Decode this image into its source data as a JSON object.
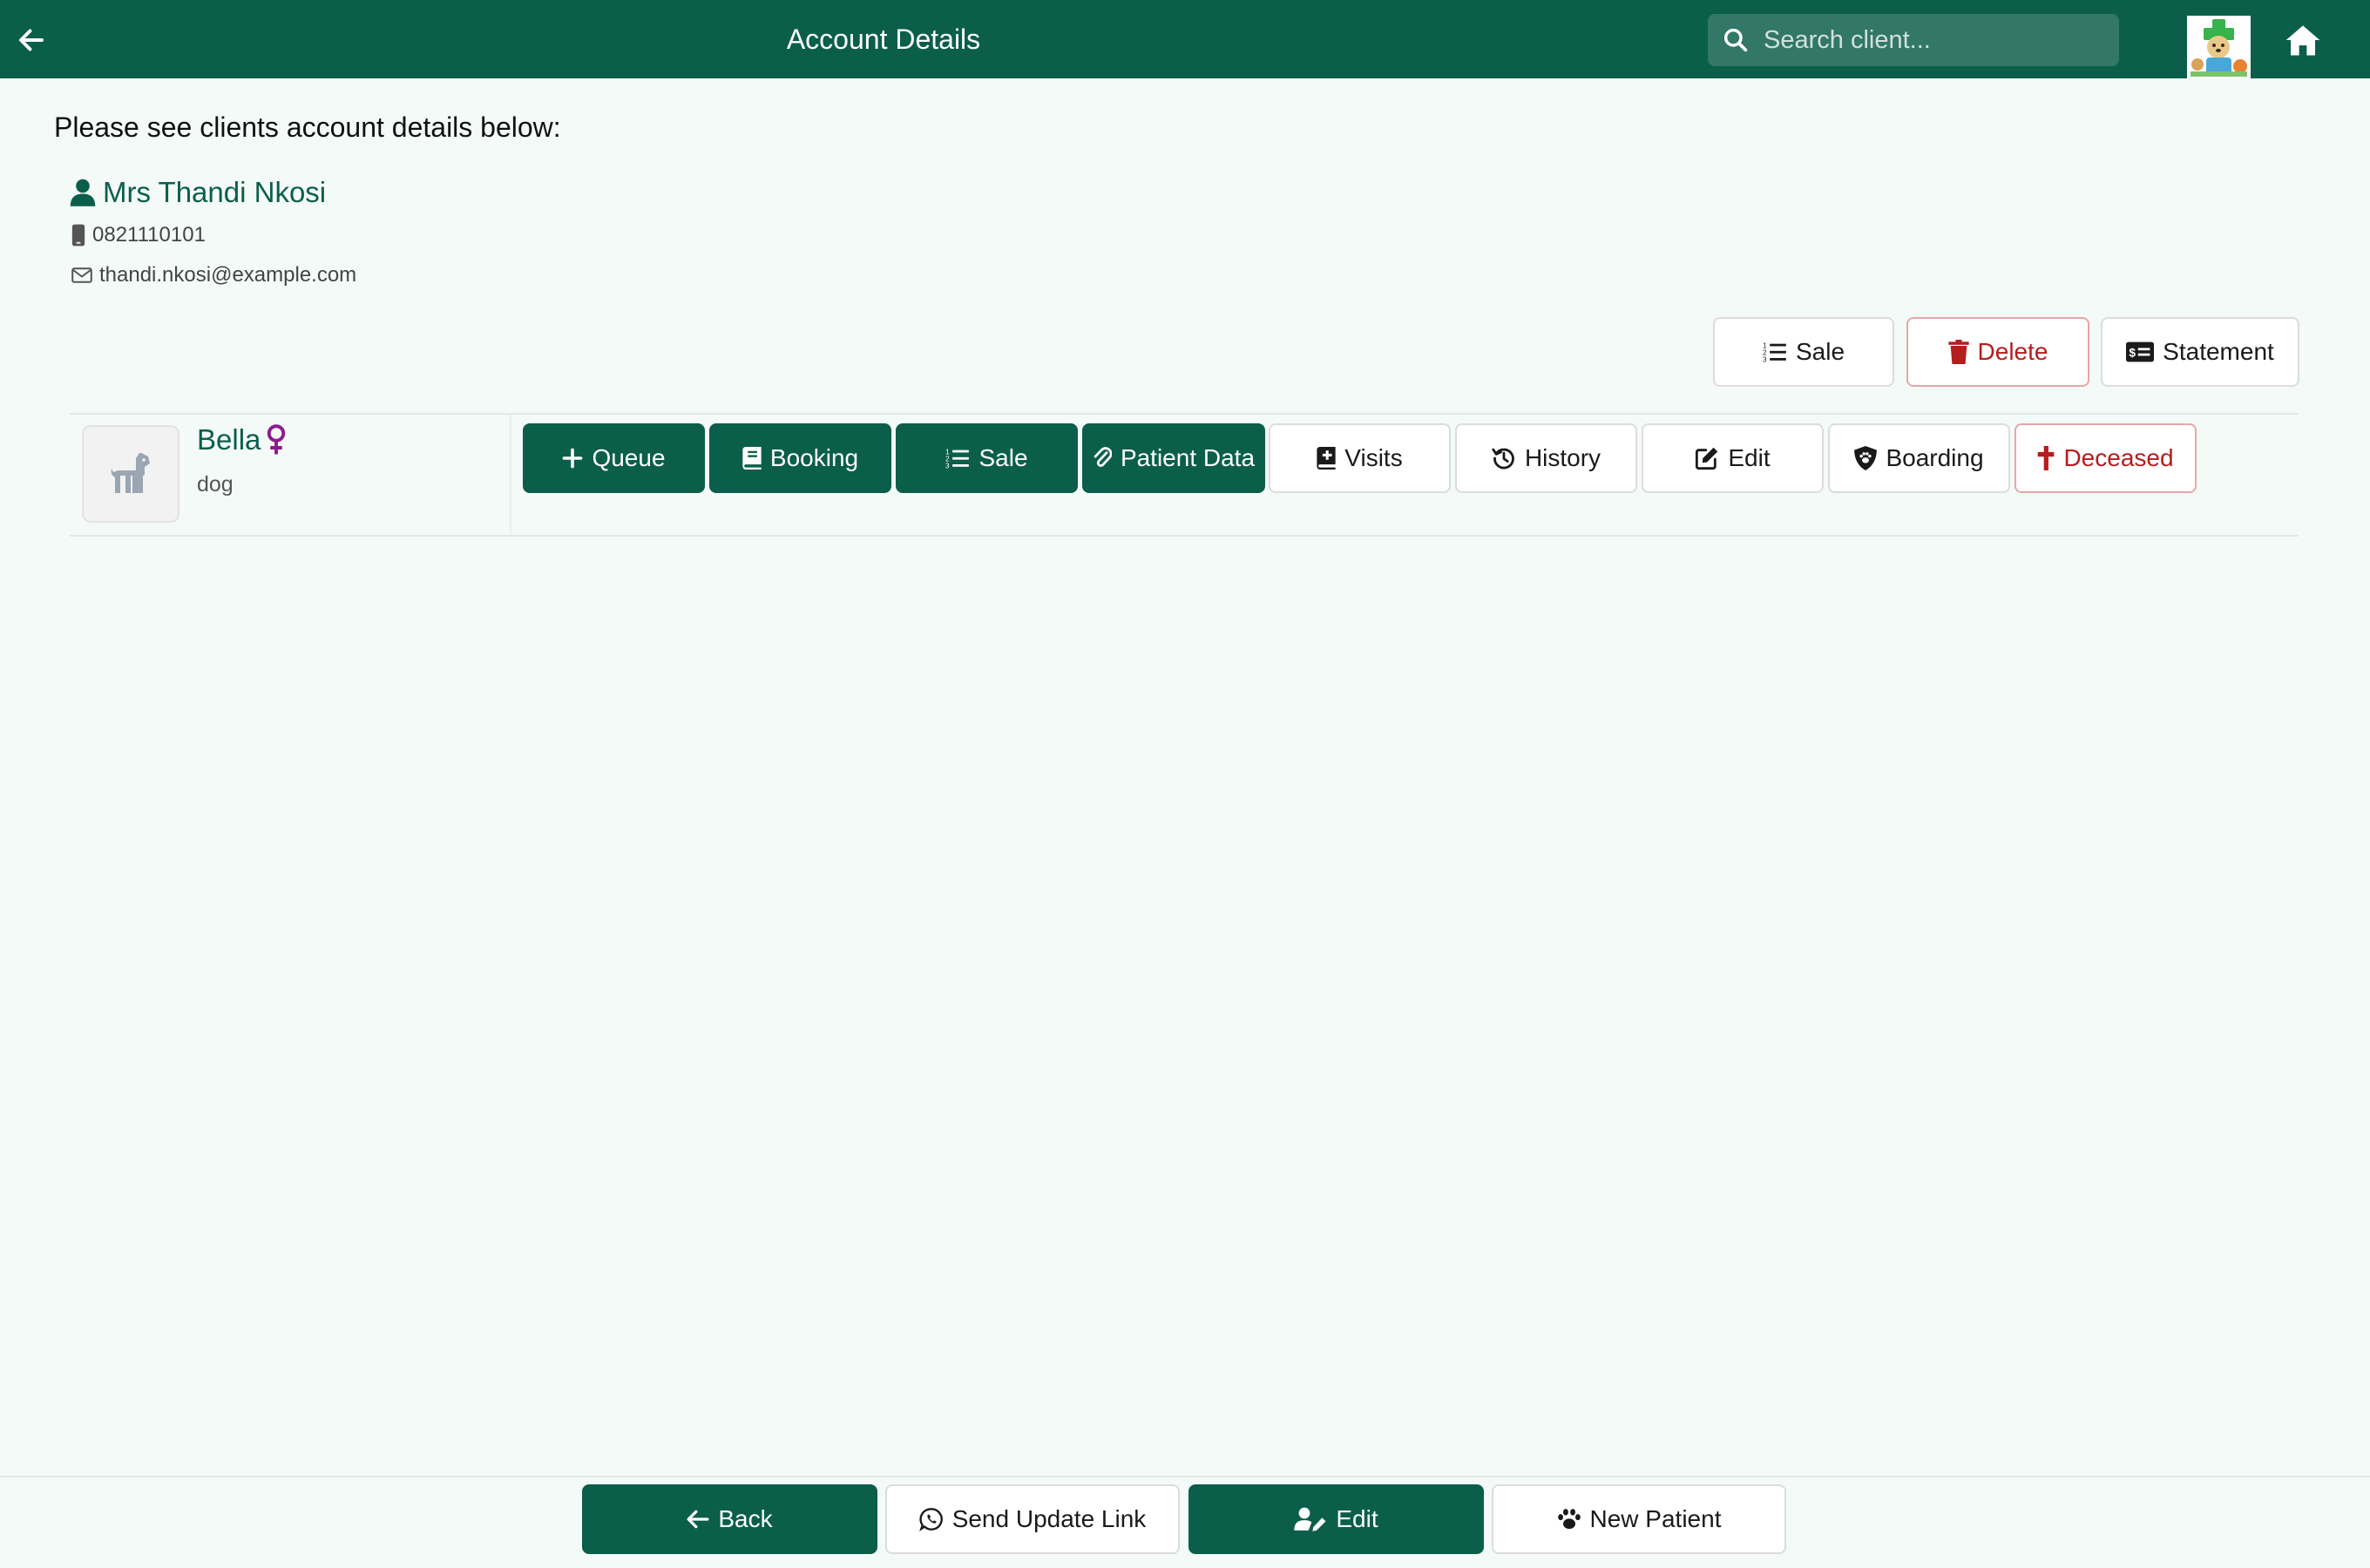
{
  "header": {
    "title": "Account Details",
    "search_placeholder": "Search client...",
    "back_icon": "arrow-left-icon",
    "home_icon": "home-icon"
  },
  "intro_text": "Please see clients account details below:",
  "client": {
    "name": "Mrs Thandi Nkosi",
    "phone": "0821110101",
    "email": "thandi.nkosi@example.com"
  },
  "account_actions": {
    "sale": "Sale",
    "delete": "Delete",
    "statement": "Statement"
  },
  "patient": {
    "name": "Bella",
    "species": "dog",
    "sex_icon": "female-icon",
    "actions": {
      "queue": "Queue",
      "booking": "Booking",
      "sale": "Sale",
      "patient_data": "Patient Data",
      "visits": "Visits",
      "history": "History",
      "edit": "Edit",
      "boarding": "Boarding",
      "deceased": "Deceased"
    }
  },
  "footer": {
    "back": "Back",
    "send_update_link": "Send Update Link",
    "edit": "Edit",
    "new_patient": "New Patient"
  },
  "colors": {
    "primary": "#0b5e4a",
    "danger": "#b31e1e",
    "female": "#8e1b8e",
    "background": "#f4faf8"
  }
}
